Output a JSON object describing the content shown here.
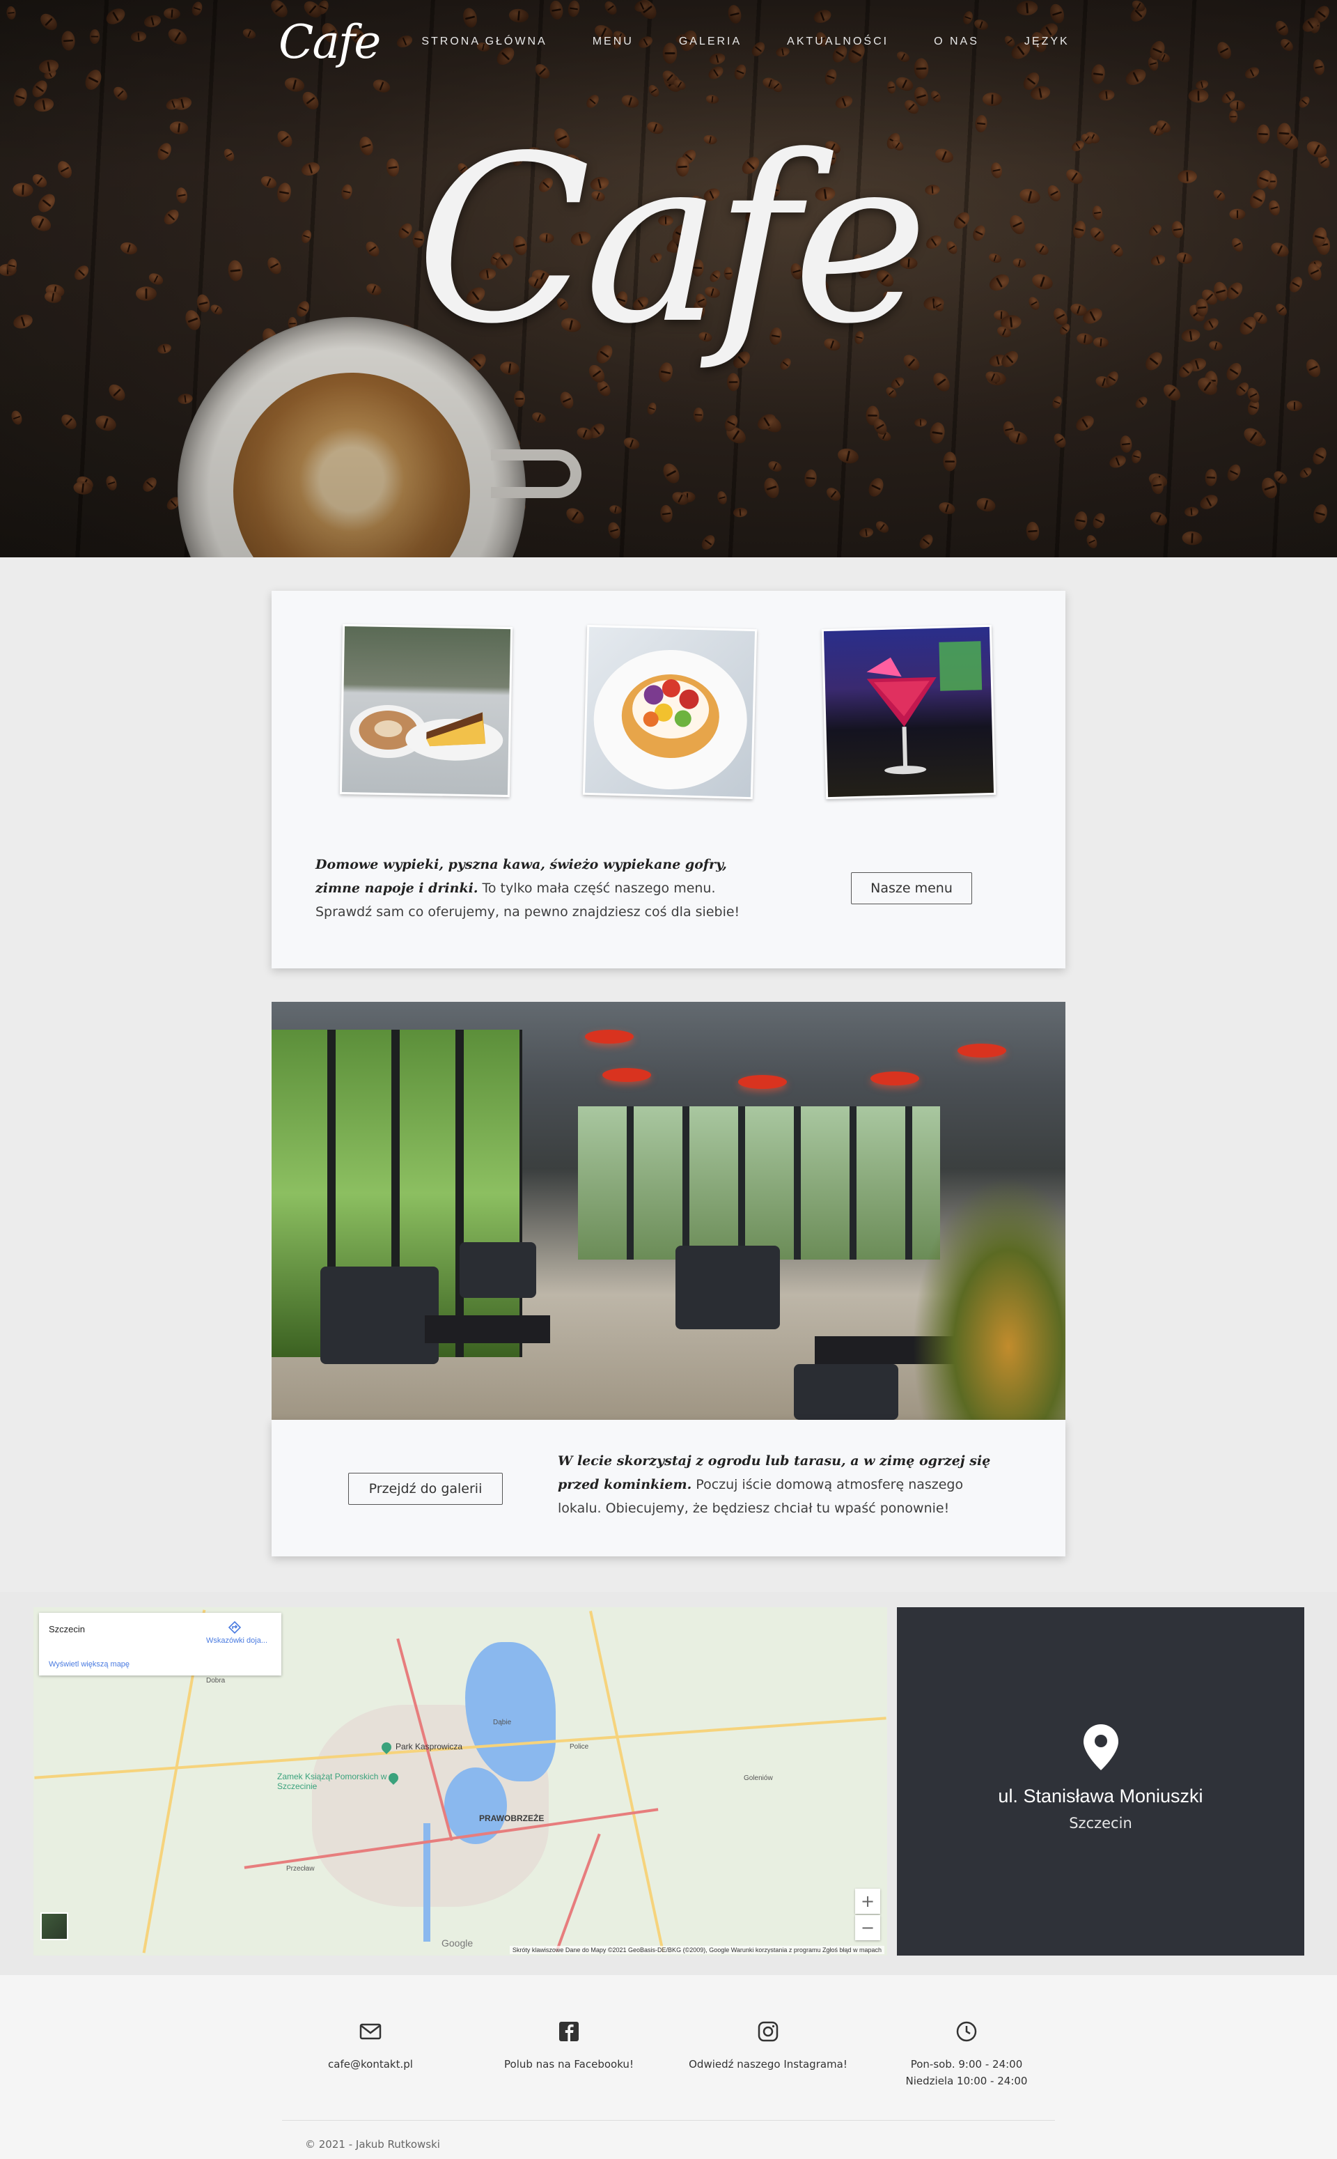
{
  "nav": {
    "logo": "Cafe",
    "items": [
      "STRONA GŁÓWNA",
      "MENU",
      "GALERIA",
      "AKTUALNOŚCI",
      "O NAS",
      "JĘZYK"
    ]
  },
  "hero": {
    "title": "Cafe"
  },
  "menu_card": {
    "lead": "Domowe wypieki, pyszna kawa, świeżo wypiekane gofry, zimne napoje i drinki.",
    "body": " To tylko mała część naszego menu. Sprawdź sam co oferujemy, na pewno znajdziesz coś dla siebie!",
    "button": "Nasze menu"
  },
  "gallery_card": {
    "lead": "W lecie skorzystaj z ogrodu lub tarasu, a w zimę ogrzej się przed kominkiem.",
    "body": " Poczuj iście domową atmosferę naszego lokalu. Obiecujemy, że będziesz chciał tu wpaść ponownie!",
    "button": "Przejdź do galerii"
  },
  "map": {
    "popup_name": "Szczecin",
    "directions": "Wskazówki doja...",
    "bigger_map": "Wyświetl większą mapę",
    "zoom_in": "+",
    "zoom_out": "−",
    "google": "Google",
    "footer": "Skróty klawiszowe   Dane do Mapy ©2021 GeoBasis-DE/BKG (©2009), Google   Warunki korzystania z programu   Zgłoś błąd w mapach",
    "places": {
      "park": "Park Kasprowicza",
      "castle": "Zamek Książąt Pomorskich w Szczecinie",
      "prawobrzeze": "PRAWOBRZEŻE",
      "police": "Police",
      "dobra": "Dobra",
      "przecław": "Przecław",
      "dabie": "Dąbie",
      "goleniow": "Goleniów"
    }
  },
  "address": {
    "street": "ul. Stanisława Moniuszki",
    "city": "Szczecin"
  },
  "footer": {
    "email": "cafe@kontakt.pl",
    "facebook": "Polub nas na Facebooku!",
    "instagram": "Odwiedź naszego Instagrama!",
    "hours_1": "Pon-sob. 9:00 - 24:00",
    "hours_2": "Niedziela 10:00 - 24:00",
    "copyright": "© 2021 - Jakub Rutkowski"
  }
}
